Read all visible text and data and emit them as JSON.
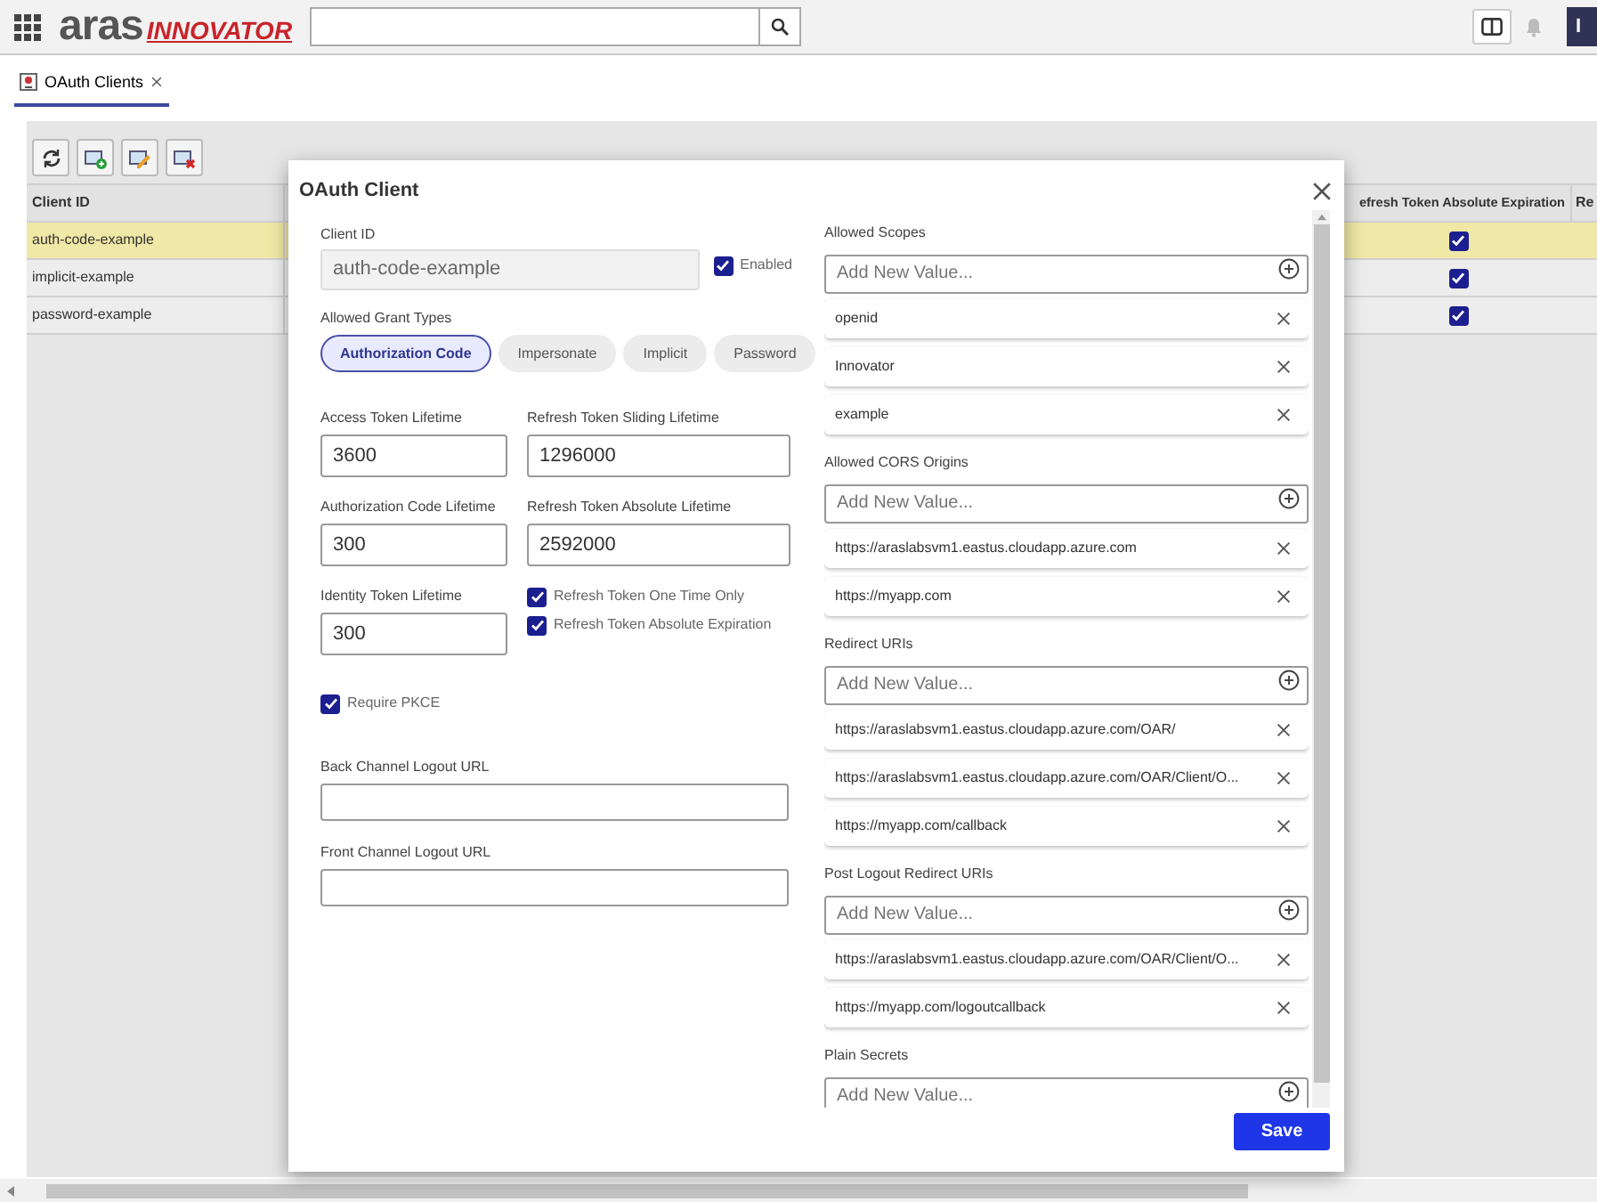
{
  "header": {
    "logo_brand": "aras",
    "logo_product": "INNOVATOR",
    "avatar": "I"
  },
  "tabs": [
    {
      "label": "OAuth Clients",
      "selected": true
    }
  ],
  "grid": {
    "columns": [
      "Client ID",
      "efresh Token Absolute Expiration",
      "Re"
    ],
    "rows": [
      {
        "client_id": "auth-code-example",
        "selected": true,
        "absolute_expiration": true
      },
      {
        "client_id": "implicit-example",
        "selected": false,
        "absolute_expiration": true
      },
      {
        "client_id": "password-example",
        "selected": false,
        "absolute_expiration": true
      }
    ]
  },
  "dialog": {
    "title": "OAuth Client",
    "client_id": {
      "label": "Client ID",
      "value": "auth-code-example"
    },
    "enabled": {
      "label": "Enabled",
      "checked": true
    },
    "grant_types": {
      "label": "Allowed Grant Types",
      "options": [
        {
          "label": "Authorization Code",
          "selected": true
        },
        {
          "label": "Impersonate",
          "selected": false
        },
        {
          "label": "Implicit",
          "selected": false
        },
        {
          "label": "Password",
          "selected": false
        }
      ]
    },
    "lifetimes": [
      {
        "label": "Access Token Lifetime",
        "value": "3600"
      },
      {
        "label": "Refresh Token Sliding Lifetime",
        "value": "1296000"
      },
      {
        "label": "Authorization Code Lifetime",
        "value": "300"
      },
      {
        "label": "Refresh Token Absolute Lifetime",
        "value": "2592000"
      },
      {
        "label": "Identity Token Lifetime",
        "value": "300"
      }
    ],
    "refresh_options": [
      {
        "label": "Refresh Token One Time Only",
        "checked": true
      },
      {
        "label": "Refresh Token Absolute Expiration",
        "checked": true
      }
    ],
    "require_pkce": {
      "label": "Require PKCE",
      "checked": true
    },
    "url_fields": [
      {
        "label": "Back Channel Logout URL"
      },
      {
        "label": "Front Channel Logout URL"
      }
    ],
    "lists": [
      {
        "label": "Allowed Scopes",
        "placeholder": "Add New Value...",
        "values": [
          "openid",
          "Innovator",
          "example"
        ]
      },
      {
        "label": "Allowed CORS Origins",
        "placeholder": "Add New Value...",
        "values": [
          "https://araslabsvm1.eastus.cloudapp.azure.com",
          "https://myapp.com"
        ]
      },
      {
        "label": "Redirect URIs",
        "placeholder": "Add New Value...",
        "values": [
          "https://araslabsvm1.eastus.cloudapp.azure.com/OAR/",
          "https://araslabsvm1.eastus.cloudapp.azure.com/OAR/Client/O...",
          "https://myapp.com/callback"
        ]
      },
      {
        "label": "Post Logout Redirect URIs",
        "placeholder": "Add New Value...",
        "values": [
          "https://araslabsvm1.eastus.cloudapp.azure.com/OAR/Client/O...",
          "https://myapp.com/logoutcallback"
        ]
      },
      {
        "label": "Plain Secrets",
        "placeholder": "Add New Value..."
      }
    ],
    "save": "Save"
  }
}
